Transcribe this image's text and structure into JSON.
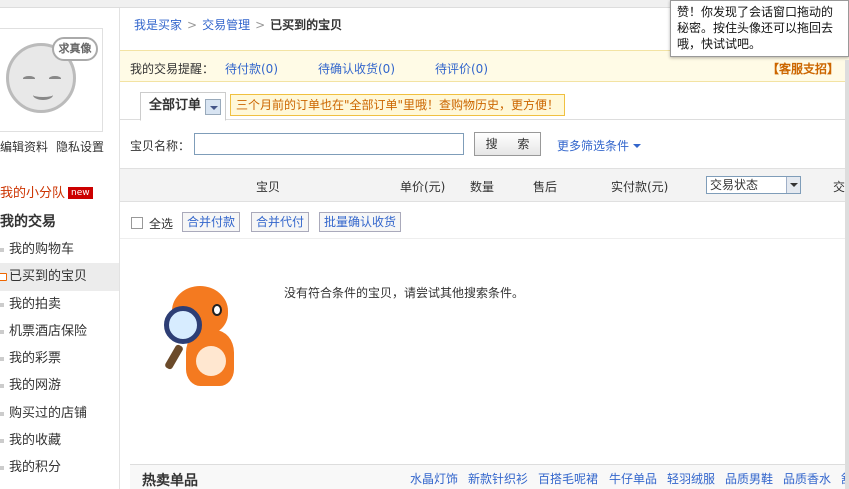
{
  "sidebar": {
    "avatar_bubble": "求真像",
    "edit_profile": "编辑资料",
    "privacy": "隐私设置",
    "team": "我的小分队",
    "team_badge": "new",
    "section_title": "我的交易",
    "items": [
      {
        "label": "我的购物车"
      },
      {
        "label": "已买到的宝贝"
      },
      {
        "label": "我的拍卖"
      },
      {
        "label": "机票酒店保险"
      },
      {
        "label": "我的彩票"
      },
      {
        "label": "我的网游"
      },
      {
        "label": "购买过的店铺"
      },
      {
        "label": "我的收藏"
      },
      {
        "label": "我的积分"
      }
    ]
  },
  "breadcrumb": {
    "items": [
      "我是买家",
      "交易管理"
    ],
    "current": "已买到的宝贝",
    "separator": ">"
  },
  "reminder": {
    "label": "我的交易提醒：",
    "pay": "待付款(0)",
    "confirm": "待确认收货(0)",
    "rate": "待评价(0)",
    "service": "【客服支招】"
  },
  "tabs": {
    "all_orders": "全部订单",
    "tip": "三个月前的订单也在\"全部订单\"里哦！查购物历史，更方便！"
  },
  "search": {
    "label": "宝贝名称：",
    "value": "",
    "button": "搜 索",
    "more": "更多筛选条件"
  },
  "columns": {
    "item": "宝贝",
    "price": "单价(元)",
    "qty": "数量",
    "after_sale": "售后",
    "paid": "实付款(元)",
    "status": "交易状态",
    "op": "交"
  },
  "batch": {
    "select_all": "全选",
    "merge_pay": "合并付款",
    "merge_agent": "合并代付",
    "batch_confirm": "批量确认收货"
  },
  "empty_message": "没有符合条件的宝贝，请尝试其他搜索条件。",
  "hot": {
    "title": "热卖单品",
    "links": [
      "水晶灯饰",
      "新款针织衫",
      "百搭毛呢裙",
      "牛仔单品",
      "轻羽绒服",
      "品质男鞋",
      "品质香水",
      "舒"
    ]
  },
  "tooltip": {
    "text": "赞！你发现了会话窗口拖动的秘密。按住头像还可以拖回去哦，快试试吧。"
  },
  "colors": {
    "link": "#3366cc",
    "accent": "#cc6600",
    "reminder_bg": "#fffbe6",
    "mascot": "#f47a20"
  }
}
